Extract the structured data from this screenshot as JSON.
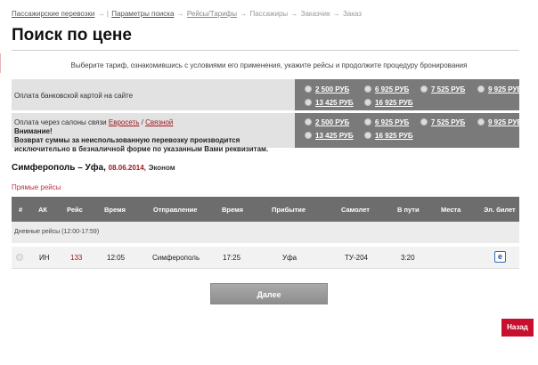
{
  "breadcrumb": {
    "step1": "Пассажирские перевозки",
    "sep1": "→ |",
    "step2": "Параметры поиска",
    "sep2": "→",
    "step3": "Рейсы/Тарифы",
    "sep3": "→",
    "step4": "Пассажиры",
    "sep4": "→",
    "step5": "Заказчик",
    "sep5": "→",
    "step6": "Заказ"
  },
  "page_title": "Поиск по цене",
  "subtitle": "Выберите тариф, ознакомившись с условиями его применения, укажите рейсы и продолжите процедуру бронирования",
  "fares": {
    "row1": {
      "label": "Оплата банковской картой на сайте",
      "prices": [
        "2 500 РУБ",
        "6 925 РУБ",
        "7 525 РУБ",
        "9 925 РУБ",
        "13 425 РУБ",
        "16 925 РУБ"
      ]
    },
    "row2": {
      "label_prefix": "Оплата через салоны связи",
      "link1": "Евросеть",
      "slash": "/",
      "link2": "Связной",
      "warning_title": "Внимание!",
      "warning_text": "Возврат суммы за неиспользованную перевозку производится исключительно в безналичной форме по указанным Вами реквизитам.",
      "prices": [
        "2 500 РУБ",
        "6 925 РУБ",
        "7 525 РУБ",
        "9 925 РУБ",
        "13 425 РУБ",
        "16 925 РУБ"
      ]
    }
  },
  "route": {
    "title": "Симферополь – Уфа,",
    "date": "08.06.2014,",
    "class": "Эконом"
  },
  "direct_flights_link": "Прямые рейсы",
  "flights_table": {
    "headers": [
      "#",
      "АК",
      "Рейс",
      "Время",
      "Отправление",
      "Время",
      "Прибытие",
      "Самолет",
      "В пути",
      "Места",
      "Эл. билет"
    ],
    "group_label": "Дневные рейсы (12:00-17:59)",
    "rows": [
      {
        "airline": "ИН",
        "flight": "133",
        "dep_time": "12:05",
        "departure": "Симферополь",
        "arr_time": "17:25",
        "arrival": "Уфа",
        "aircraft": "ТУ-204",
        "duration": "3:20",
        "seats": "",
        "eticket": "e"
      }
    ]
  },
  "buttons": {
    "next": "Далее",
    "back": "Назад"
  }
}
